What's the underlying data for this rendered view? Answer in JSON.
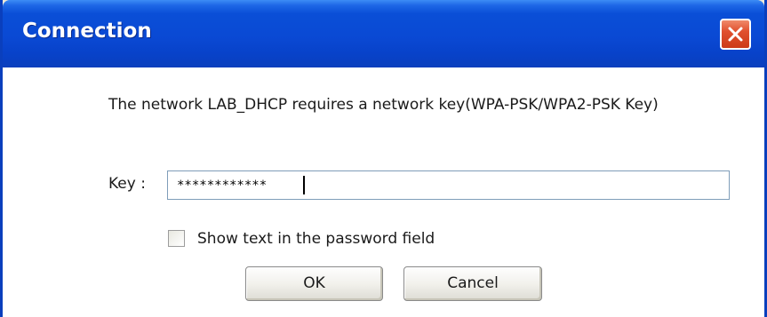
{
  "window": {
    "title": "Connection"
  },
  "dialog": {
    "message": "The network LAB_DHCP requires a network key(WPA-PSK/WPA2-PSK Key)",
    "key_label": "Key :",
    "key_value": "************",
    "show_text_label": "Show text in the password field",
    "show_text_checked": false,
    "ok_label": "OK",
    "cancel_label": "Cancel"
  },
  "icons": {
    "close": "close-icon"
  },
  "colors": {
    "titlebar": "#0a49d4",
    "close_button": "#e0502e",
    "client_background": "#ffffff"
  }
}
